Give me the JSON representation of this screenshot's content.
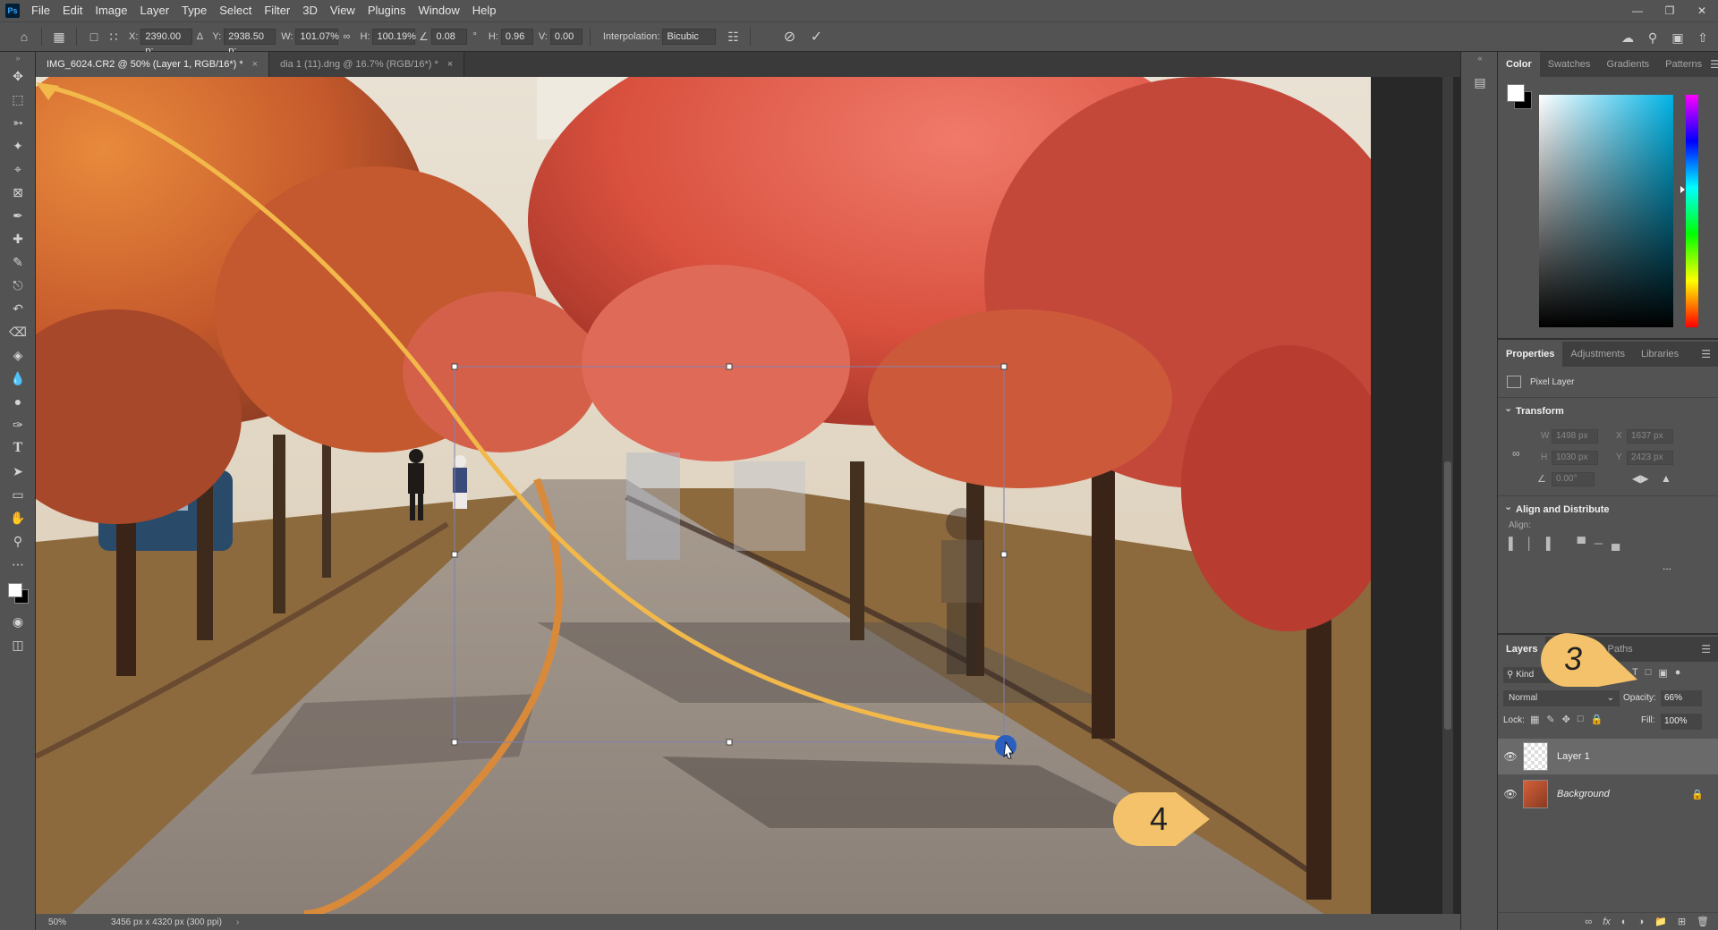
{
  "menubar": {
    "logo": "Ps",
    "items": [
      "File",
      "Edit",
      "Image",
      "Layer",
      "Type",
      "Select",
      "Filter",
      "3D",
      "View",
      "Plugins",
      "Window",
      "Help"
    ]
  },
  "options": {
    "x_label": "X:",
    "x_value": "2390.00 p:",
    "y_label": "Y:",
    "y_value": "2938.50 p:",
    "w_label": "W:",
    "w_value": "101.07%",
    "h_label": "H:",
    "h_value": "100.19%",
    "angle_value": "0.08",
    "angle_unit": "°",
    "hskew_label": "H:",
    "hskew_value": "0.96",
    "vskew_label": "V:",
    "vskew_value": "0.00",
    "interp_label": "Interpolation:",
    "interp_value": "Bicubic"
  },
  "tabs": [
    {
      "label": "IMG_6024.CR2 @ 50% (Layer 1, RGB/16*) *",
      "active": true
    },
    {
      "label": "dia 1 (11).dng @ 16.7% (RGB/16*) *",
      "active": false
    }
  ],
  "status": {
    "zoom": "50%",
    "doc_info": "3456 px x 4320 px (300 ppi)"
  },
  "color_panel": {
    "tabs": [
      "Color",
      "Swatches",
      "Gradients",
      "Patterns"
    ],
    "colors": {
      "fg": "#ffffff",
      "bg": "#000000",
      "hue": "#00b4e6"
    }
  },
  "properties_panel": {
    "tabs": [
      "Properties",
      "Adjustments",
      "Libraries"
    ],
    "kind": "Pixel Layer",
    "transform_title": "Transform",
    "w_label": "W",
    "w_value": "1498 px",
    "x_label": "X",
    "x_value": "1637 px",
    "h_label": "H",
    "h_value": "1030 px",
    "y_label": "Y",
    "y_value": "2423 px",
    "angle_value": "0.00°",
    "align_title": "Align and Distribute",
    "align_label": "Align:",
    "more": "..."
  },
  "layers_panel": {
    "tabs": [
      "Layers",
      "Paths"
    ],
    "filter_label": "Kind",
    "blend_mode": "Normal",
    "opacity_label": "Opacity:",
    "opacity_value": "66%",
    "lock_label": "Lock:",
    "fill_label": "Fill:",
    "fill_value": "100%",
    "layers": [
      {
        "name": "Layer 1",
        "selected": true
      },
      {
        "name": "Background",
        "selected": false,
        "locked": true
      }
    ]
  },
  "callouts": [
    {
      "label": "3"
    },
    {
      "label": "4"
    }
  ]
}
